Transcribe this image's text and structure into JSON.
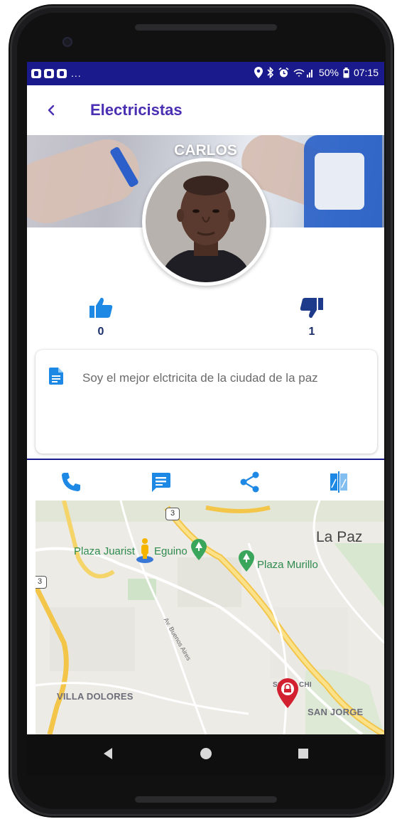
{
  "status_bar": {
    "battery": "50%",
    "time": "07:15",
    "dots": "..."
  },
  "app_bar": {
    "title": "Electricistas"
  },
  "profile": {
    "name": "CARLOS",
    "likes": "0",
    "dislikes": "1",
    "description": "Soy el mejor elctricita de la ciudad de la paz"
  },
  "actions": {
    "icons": [
      "phone-icon",
      "chat-icon",
      "share-icon",
      "compare-icon"
    ]
  },
  "map": {
    "city": "La Paz",
    "places": [
      "Plaza Juarist",
      "Eguino",
      "Plaza Murillo"
    ],
    "districts": [
      "VILLA DOLORES",
      "SAN JORGE",
      "SOP",
      "CHI"
    ],
    "street": "Av. Buenos Aires",
    "shield_3": "3"
  },
  "colors": {
    "status_bar": "#1a1a8c",
    "title": "#4a2fb3",
    "icon_blue": "#1e88e5",
    "count": "#1b2f6b"
  }
}
